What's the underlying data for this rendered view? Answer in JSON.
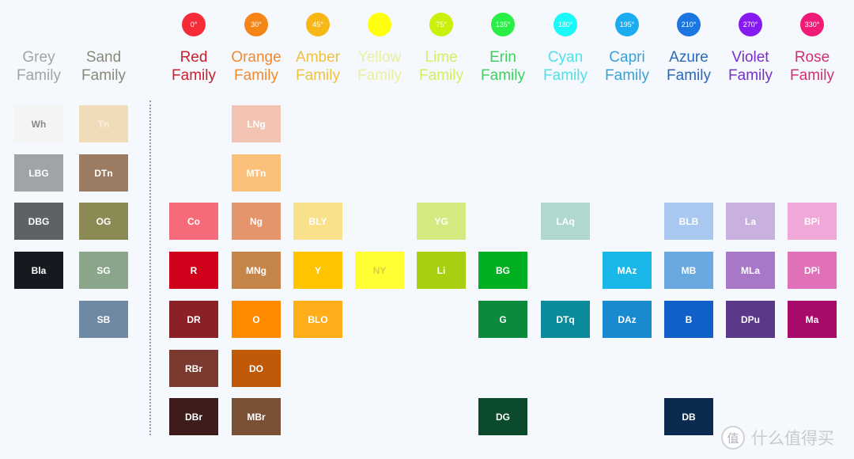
{
  "families": [
    {
      "id": "grey",
      "label_line1": "Grey",
      "label_line2": "Family",
      "label_color": "#a0a4a8",
      "hue": null,
      "tiles": [
        {
          "row": 0,
          "code": "Wh",
          "color": "#f4f4f4",
          "text_color": "#8a8a8a"
        },
        {
          "row": 1,
          "code": "LBG",
          "color": "#9ea4a8"
        },
        {
          "row": 2,
          "code": "DBG",
          "color": "#5e6266"
        },
        {
          "row": 3,
          "code": "Bla",
          "color": "#141a1f"
        }
      ]
    },
    {
      "id": "sand",
      "label_line1": "Sand",
      "label_line2": "Family",
      "label_color": "#8a8a78",
      "hue": null,
      "tiles": [
        {
          "row": 0,
          "code": "Tn",
          "color": "#f0dcb8",
          "text_color": "#f8f0e0"
        },
        {
          "row": 1,
          "code": "DTn",
          "color": "#9b7c62"
        },
        {
          "row": 2,
          "code": "OG",
          "color": "#8b8a55"
        },
        {
          "row": 3,
          "code": "SG",
          "color": "#8aa58a"
        },
        {
          "row": 4,
          "code": "SB",
          "color": "#6f88a3"
        }
      ]
    },
    {
      "id": "red",
      "label_line1": "Red",
      "label_line2": "Family",
      "label_color": "#c8202c",
      "hue": {
        "label": "0°",
        "color": "#f5222d"
      },
      "tiles": [
        {
          "row": 2,
          "code": "Co",
          "color": "#f76a7a"
        },
        {
          "row": 3,
          "code": "R",
          "color": "#d0021b"
        },
        {
          "row": 4,
          "code": "DR",
          "color": "#8b2027"
        },
        {
          "row": 5,
          "code": "RBr",
          "color": "#7a3a30"
        },
        {
          "row": 6,
          "code": "DBr",
          "color": "#3e1c1c"
        }
      ]
    },
    {
      "id": "orange",
      "label_line1": "Orange",
      "label_line2": "Family",
      "label_color": "#f08a30",
      "hue": {
        "label": "30°",
        "color": "#f57f0a"
      },
      "tiles": [
        {
          "row": 0,
          "code": "LNg",
          "color": "#f2c3b2"
        },
        {
          "row": 1,
          "code": "MTn",
          "color": "#fbc07a"
        },
        {
          "row": 2,
          "code": "Ng",
          "color": "#e5956b"
        },
        {
          "row": 3,
          "code": "MNg",
          "color": "#c58448"
        },
        {
          "row": 4,
          "code": "O",
          "color": "#ff8a00"
        },
        {
          "row": 5,
          "code": "DO",
          "color": "#c05a08"
        },
        {
          "row": 6,
          "code": "MBr",
          "color": "#7a5134"
        }
      ]
    },
    {
      "id": "amber",
      "label_line1": "Amber",
      "label_line2": "Family",
      "label_color": "#f0c040",
      "hue": {
        "label": "45°",
        "color": "#f8b40a"
      },
      "tiles": [
        {
          "row": 2,
          "code": "BLY",
          "color": "#f9e08a"
        },
        {
          "row": 3,
          "code": "Y",
          "color": "#ffc400"
        },
        {
          "row": 4,
          "code": "BLO",
          "color": "#ffae1a"
        }
      ]
    },
    {
      "id": "yellow",
      "label_line1": "Yellow",
      "label_line2": "Family",
      "label_color": "#e8f0a0",
      "hue": {
        "label": "",
        "color": "#ffff00"
      },
      "tiles": [
        {
          "row": 3,
          "code": "NY",
          "color": "#ffff33",
          "text_color": "#d8d040"
        }
      ]
    },
    {
      "id": "lime",
      "label_line1": "Lime",
      "label_line2": "Family",
      "label_color": "#d0f060",
      "hue": {
        "label": "75°",
        "color": "#c8f000"
      },
      "tiles": [
        {
          "row": 2,
          "code": "YG",
          "color": "#d4ea80"
        },
        {
          "row": 3,
          "code": "Li",
          "color": "#a8d010"
        }
      ]
    },
    {
      "id": "erin",
      "label_line1": "Erin",
      "label_line2": "Family",
      "label_color": "#40d060",
      "hue": {
        "label": "135°",
        "color": "#1eee3c"
      },
      "tiles": [
        {
          "row": 3,
          "code": "BG",
          "color": "#00b020"
        },
        {
          "row": 4,
          "code": "G",
          "color": "#0a8a3a"
        },
        {
          "row": 6,
          "code": "DG",
          "color": "#0b4a2a"
        }
      ]
    },
    {
      "id": "cyan",
      "label_line1": "Cyan",
      "label_line2": "Family",
      "label_color": "#50e0e8",
      "hue": {
        "label": "180°",
        "color": "#10f8f8"
      },
      "tiles": [
        {
          "row": 2,
          "code": "LAq",
          "color": "#b0d8d0"
        },
        {
          "row": 4,
          "code": "DTq",
          "color": "#0a8a9a"
        }
      ]
    },
    {
      "id": "capri",
      "label_line1": "Capri",
      "label_line2": "Family",
      "label_color": "#3aa0d8",
      "hue": {
        "label": "195°",
        "color": "#10a8f0"
      },
      "tiles": [
        {
          "row": 3,
          "code": "MAz",
          "color": "#1ab8e8"
        },
        {
          "row": 4,
          "code": "DAz",
          "color": "#1a8ad0"
        }
      ]
    },
    {
      "id": "azure",
      "label_line1": "Azure",
      "label_line2": "Family",
      "label_color": "#2a68b8",
      "hue": {
        "label": "210°",
        "color": "#1070e0"
      },
      "tiles": [
        {
          "row": 2,
          "code": "BLB",
          "color": "#a8c8f0"
        },
        {
          "row": 3,
          "code": "MB",
          "color": "#6aa8e0"
        },
        {
          "row": 4,
          "code": "B",
          "color": "#1060c8"
        },
        {
          "row": 6,
          "code": "DB",
          "color": "#0a2a50"
        }
      ]
    },
    {
      "id": "violet",
      "label_line1": "Violet",
      "label_line2": "Family",
      "label_color": "#7a30c8",
      "hue": {
        "label": "270°",
        "color": "#8010f0"
      },
      "tiles": [
        {
          "row": 2,
          "code": "La",
          "color": "#c8b0e0"
        },
        {
          "row": 3,
          "code": "MLa",
          "color": "#a878c8"
        },
        {
          "row": 4,
          "code": "DPu",
          "color": "#5a3a88"
        }
      ]
    },
    {
      "id": "rose",
      "label_line1": "Rose",
      "label_line2": "Family",
      "label_color": "#d03070",
      "hue": {
        "label": "330°",
        "color": "#f01070"
      },
      "tiles": [
        {
          "row": 2,
          "code": "BPi",
          "color": "#f0a8d8"
        },
        {
          "row": 3,
          "code": "DPi",
          "color": "#e070b8"
        },
        {
          "row": 4,
          "code": "Ma",
          "color": "#a80a6a"
        }
      ]
    }
  ],
  "watermark": {
    "logo": "值",
    "text": "什么值得买"
  }
}
